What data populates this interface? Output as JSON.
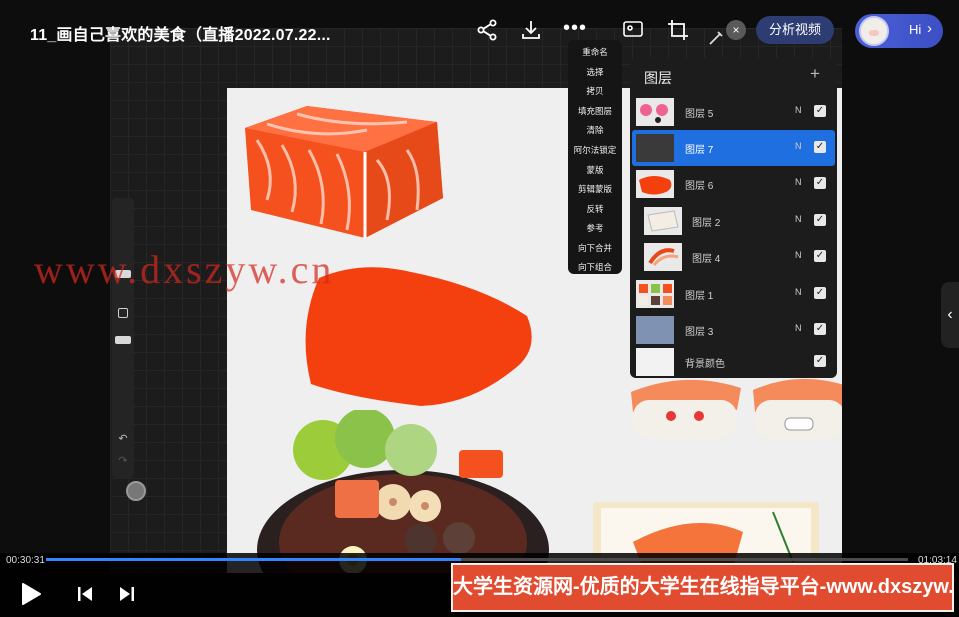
{
  "video": {
    "title": "11_画自己喜欢的美食（直播2022.07.22...",
    "time_current": "00:30:31",
    "time_total": "01:03:14",
    "progress": 0.482
  },
  "topbar": {
    "share_icon": "share-icon",
    "download_icon": "download-icon",
    "more_label": "•••",
    "close_label": "×",
    "analyze_label": "分析视频",
    "hi_label": "Hi",
    "hi_chevron": "›"
  },
  "context_menu": {
    "items": [
      "重命名",
      "选择",
      "拷贝",
      "填充图层",
      "清除",
      "阿尔法锁定",
      "蒙版",
      "剪辑蒙版",
      "反转",
      "参考",
      "向下合并",
      "向下组合"
    ]
  },
  "layers_panel": {
    "title": "图层",
    "add_label": "+",
    "layers": [
      {
        "name": "图层 5",
        "blend": "N",
        "visible": true,
        "active": false
      },
      {
        "name": "图层 7",
        "blend": "N",
        "visible": true,
        "active": true
      },
      {
        "name": "图层 6",
        "blend": "N",
        "visible": true,
        "active": false
      },
      {
        "name": "图层 2",
        "blend": "N",
        "visible": true,
        "active": false
      },
      {
        "name": "图层 4",
        "blend": "N",
        "visible": true,
        "active": false
      },
      {
        "name": "图层 1",
        "blend": "N",
        "visible": true,
        "active": false
      },
      {
        "name": "图层 3",
        "blend": "N",
        "visible": true,
        "active": false
      },
      {
        "name": "背景颜色",
        "blend": "",
        "visible": true,
        "active": false
      }
    ]
  },
  "watermark": "www.dxszyw.cn",
  "banner": "大学生资源网-优质的大学生在线指导平台-www.dxszyw.cn",
  "colors": {
    "accent_blue": "#1f6fe0",
    "progress_blue": "#2f86ff",
    "banner_red": "#e14b2f",
    "salmon": "#f4511e"
  }
}
